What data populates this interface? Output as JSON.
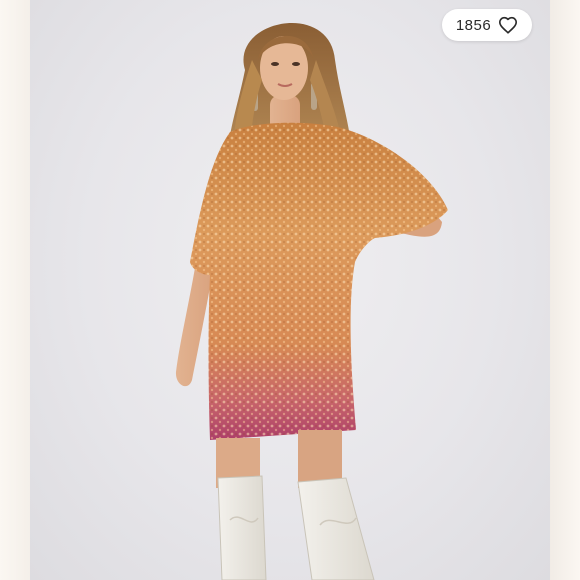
{
  "listing": {
    "like_count": "1856",
    "like_icon": "heart-outline-icon",
    "image_subject": "product-photo"
  },
  "colors": {
    "background": "#e7e6ea",
    "badge": "#ffffff",
    "sequin_top": "#d4894c",
    "sequin_bottom": "#b8476a",
    "boots": "#ece9e2"
  }
}
